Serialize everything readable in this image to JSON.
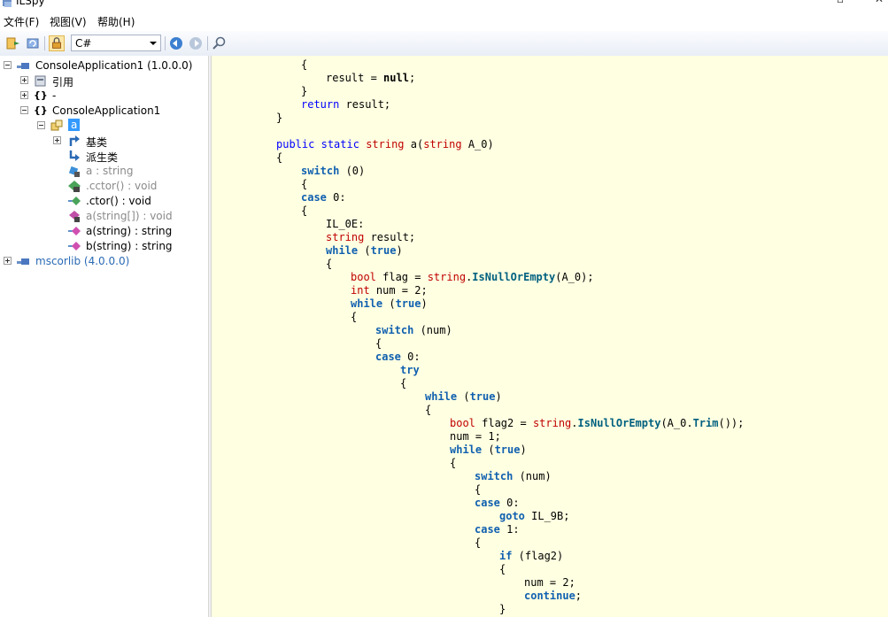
{
  "window": {
    "title": "ILSpy"
  },
  "menu": {
    "items": [
      "文件(F)",
      "视图(V)",
      "帮助(H)"
    ]
  },
  "toolbar": {
    "language": "C#"
  },
  "tree": {
    "nodes": [
      {
        "label": "ConsoleApplication1 (1.0.0.0)"
      },
      {
        "label": "引用"
      },
      {
        "label": "-"
      },
      {
        "label": "ConsoleApplication1"
      },
      {
        "label": "a"
      },
      {
        "label": "基类"
      },
      {
        "label": "派生类"
      },
      {
        "label": "a : string"
      },
      {
        "label": ".cctor() : void"
      },
      {
        "label": ".ctor() : void"
      },
      {
        "label": "a(string[]) : void"
      },
      {
        "label": "a(string) : string"
      },
      {
        "label": "b(string) : string"
      },
      {
        "label": "mscorlib (4.0.0.0)"
      }
    ]
  },
  "code": {
    "lines": [
      "{",
      "result = ",
      "null",
      ";",
      "}",
      "return",
      " result;",
      "}",
      "public",
      "static",
      "string",
      " a(",
      "string",
      " A_0)",
      "{",
      "switch",
      " (0)",
      "{",
      "case",
      " 0:",
      "{",
      "IL_0E:",
      "string",
      " result;",
      "while",
      " (",
      "true",
      ")",
      "{",
      "bool",
      " flag = ",
      "string",
      ".",
      "IsNullOrEmpty",
      "(A_0);",
      "int",
      " num = 2;",
      "while",
      " (",
      "true",
      ")",
      "{",
      "switch",
      " (num)",
      "{",
      "case",
      " 0:",
      "try",
      "{",
      "while",
      " (",
      "true",
      ")",
      "{",
      "bool",
      " flag2 = ",
      "string",
      ".",
      "IsNullOrEmpty",
      "(A_0.",
      "Trim",
      "());",
      "num = 1;",
      "while",
      " (",
      "true",
      ")",
      "{",
      "switch",
      " (num)",
      "{",
      "case",
      " 0:",
      "goto",
      " IL_9B;",
      "case",
      " 1:",
      "{",
      "if",
      " (flag2)",
      "{",
      "num = 2;",
      "continue",
      ";",
      "}"
    ]
  },
  "colors": {
    "code_bg": "#ffffe1",
    "keyword": "#0000ff",
    "type": "#c00000",
    "selection": "#3399ff"
  }
}
